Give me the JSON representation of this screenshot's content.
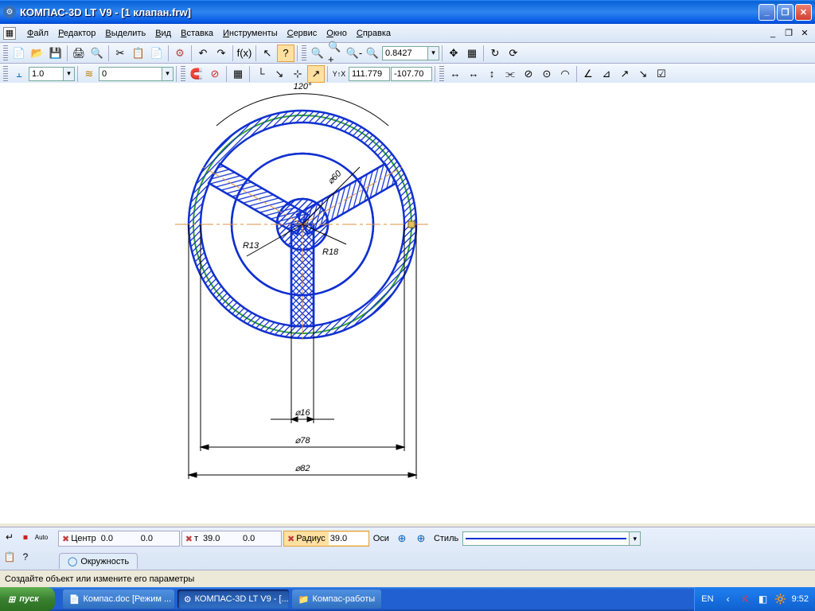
{
  "title": "КОМПАС-3D LT V9 - [1 клапан.frw]",
  "menu": [
    "Файл",
    "Редактор",
    "Выделить",
    "Вид",
    "Вставка",
    "Инструменты",
    "Сервис",
    "Окно",
    "Справка"
  ],
  "toolbar1": {
    "zoom": "0.8427"
  },
  "toolbar2": {
    "step": "1.0",
    "layer": "0",
    "coordX": "111.779",
    "coordY": "-107.70"
  },
  "drawing": {
    "angle_label": "120°",
    "d60": "⌀60",
    "r13": "R13",
    "r18": "R18",
    "d16": "⌀16",
    "d78": "⌀78",
    "d82": "⌀82"
  },
  "properties": {
    "center_label": "Центр",
    "cx": "0.0",
    "cy": "0.0",
    "t_label": "т",
    "tx": "39.0",
    "ty": "0.0",
    "radius_label": "Радиус",
    "radius": "39.0",
    "axes_label": "Оси",
    "style_label": "Стиль",
    "tab": "Окружность"
  },
  "status": "Создайте объект или измените его параметры",
  "taskbar": {
    "start": "пуск",
    "items": [
      "Компас.doc [Режим ...",
      "КОМПАС-3D LT V9 - [...",
      "Компас-работы"
    ],
    "lang": "EN",
    "clock": "9:52"
  }
}
